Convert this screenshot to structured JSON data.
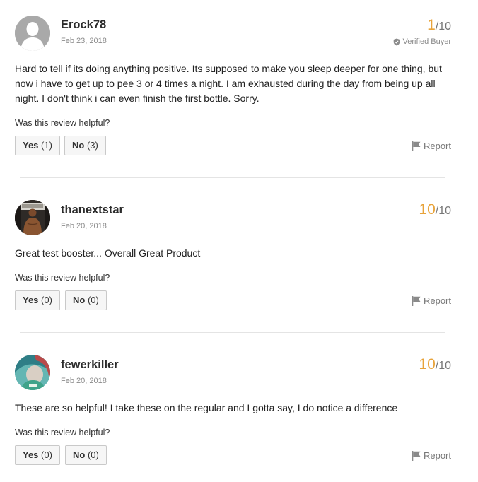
{
  "reviews": [
    {
      "username": "Erock78",
      "date": "Feb 23, 2018",
      "score": "1",
      "out_of": "/10",
      "verified_label": "Verified Buyer",
      "text": "Hard to tell if its doing anything positive. Its supposed to make you sleep deeper for one thing, but now i have to get up to pee 3 or 4 times a night. I am exhausted during the day from being up all night. I don't think i can even finish the first bottle. Sorry.",
      "helpful_prompt": "Was this review helpful?",
      "yes_label": "Yes",
      "yes_count": "(1)",
      "no_label": "No",
      "no_count": "(3)",
      "report_label": "Report",
      "avatar_icon": "default-user-silhouette"
    },
    {
      "username": "thanextstar",
      "date": "Feb 20, 2018",
      "score": "10",
      "out_of": "/10",
      "text": "Great test booster... Overall Great Product",
      "helpful_prompt": "Was this review helpful?",
      "yes_label": "Yes",
      "yes_count": "(0)",
      "no_label": "No",
      "no_count": "(0)",
      "report_label": "Report",
      "avatar_icon": "user-photo"
    },
    {
      "username": "fewerkiller",
      "date": "Feb 20, 2018",
      "score": "10",
      "out_of": "/10",
      "text": "These are so helpful! I take these on the regular and I gotta say, I do notice a difference",
      "helpful_prompt": "Was this review helpful?",
      "yes_label": "Yes",
      "yes_count": "(0)",
      "no_label": "No",
      "no_count": "(0)",
      "report_label": "Report",
      "avatar_icon": "user-photo"
    }
  ],
  "colors": {
    "score": "#e8a33a",
    "muted": "#8b8b8b",
    "button_bg": "#f6f6f6",
    "button_border": "#c9c9c9",
    "divider": "#e4e4e4"
  }
}
